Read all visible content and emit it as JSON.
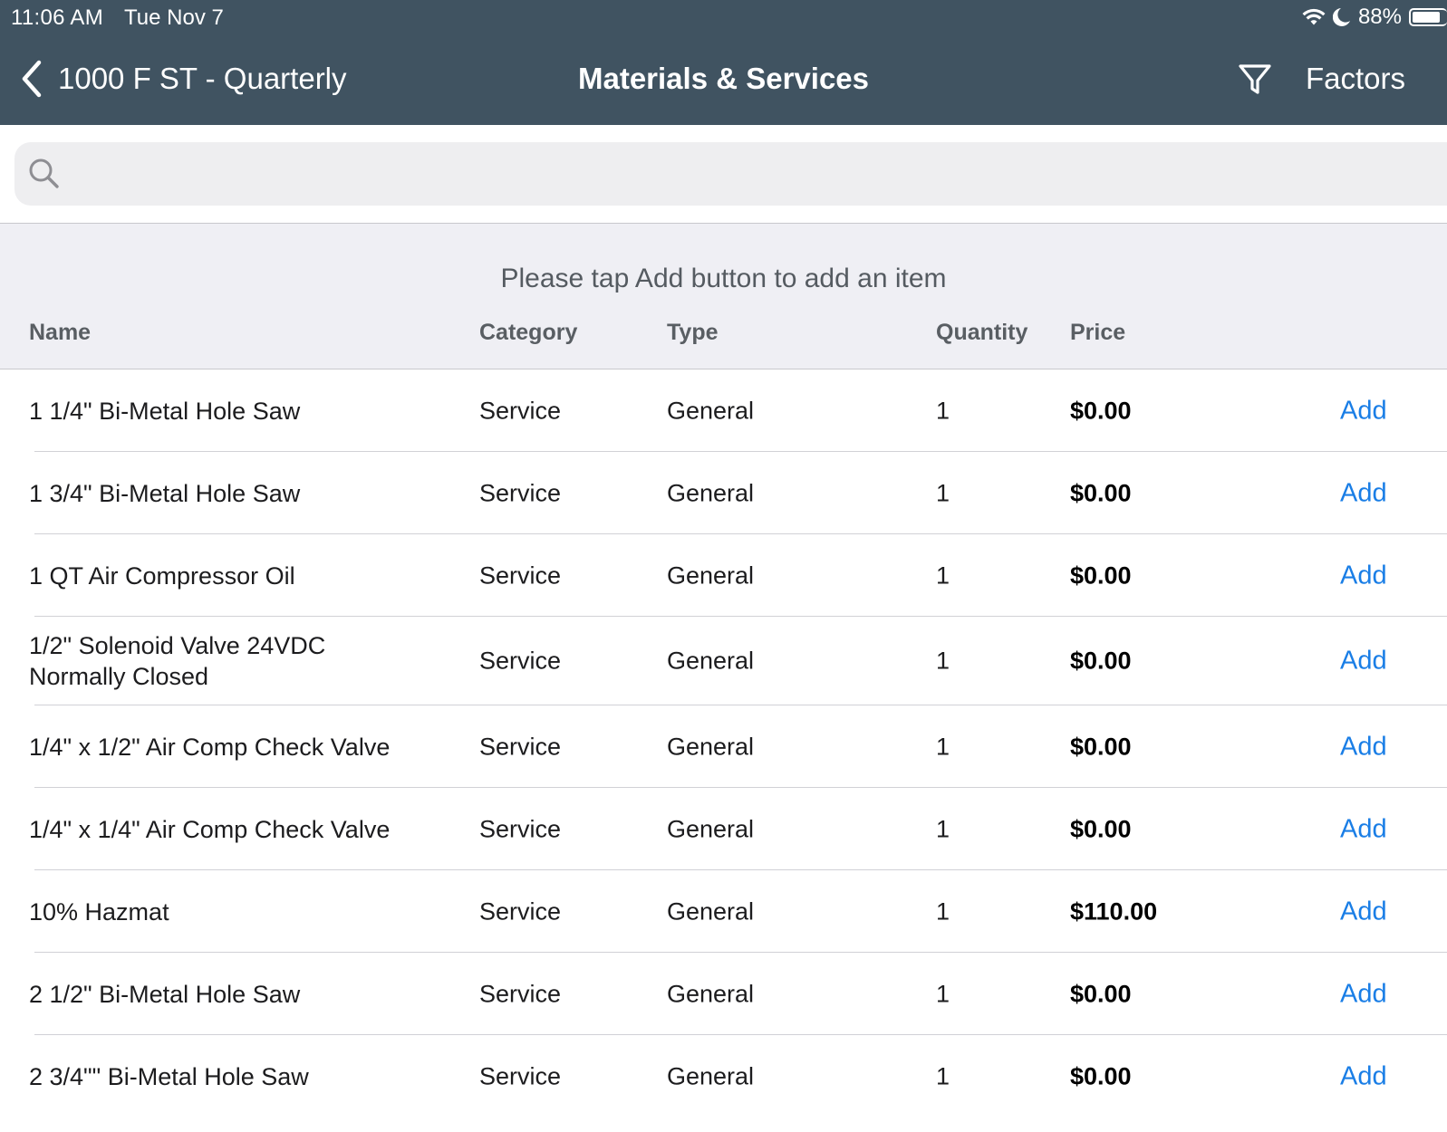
{
  "status_bar": {
    "time": "11:06 AM",
    "date": "Tue Nov 7",
    "battery": "88%",
    "battery_level": 0.88,
    "icons": [
      "wifi-icon",
      "moon-icon",
      "battery-icon"
    ]
  },
  "nav": {
    "back_label": "1000 F ST - Quarterly",
    "title": "Materials & Services",
    "factors_label": "Factors",
    "icons": [
      "chevron-left-icon",
      "filter-icon"
    ]
  },
  "search": {
    "placeholder": "",
    "value": "",
    "icon": "search-icon"
  },
  "hint": "Please tap Add button to add an item",
  "columns": {
    "name": "Name",
    "category": "Category",
    "type": "Type",
    "quantity": "Quantity",
    "price": "Price"
  },
  "items": [
    {
      "name": "1 1/4\" Bi-Metal Hole Saw",
      "category": "Service",
      "type": "General",
      "quantity": "1",
      "price": "$0.00",
      "action": "Add"
    },
    {
      "name": "1 3/4\" Bi-Metal Hole Saw",
      "category": "Service",
      "type": "General",
      "quantity": "1",
      "price": "$0.00",
      "action": "Add"
    },
    {
      "name": "1 QT Air Compressor Oil",
      "category": "Service",
      "type": "General",
      "quantity": "1",
      "price": "$0.00",
      "action": "Add"
    },
    {
      "name": "1/2\" Solenoid Valve 24VDC Normally Closed",
      "category": "Service",
      "type": "General",
      "quantity": "1",
      "price": "$0.00",
      "action": "Add"
    },
    {
      "name": "1/4\" x 1/2\" Air Comp Check Valve",
      "category": "Service",
      "type": "General",
      "quantity": "1",
      "price": "$0.00",
      "action": "Add"
    },
    {
      "name": "1/4\" x 1/4\" Air Comp Check Valve",
      "category": "Service",
      "type": "General",
      "quantity": "1",
      "price": "$0.00",
      "action": "Add"
    },
    {
      "name": "10% Hazmat",
      "category": "Service",
      "type": "General",
      "quantity": "1",
      "price": "$110.00",
      "action": "Add"
    },
    {
      "name": "2 1/2\" Bi-Metal Hole Saw",
      "category": "Service",
      "type": "General",
      "quantity": "1",
      "price": "$0.00",
      "action": "Add"
    },
    {
      "name": "2 3/4\"\" Bi-Metal Hole Saw",
      "category": "Service",
      "type": "General",
      "quantity": "1",
      "price": "$0.00",
      "action": "Add"
    }
  ]
}
